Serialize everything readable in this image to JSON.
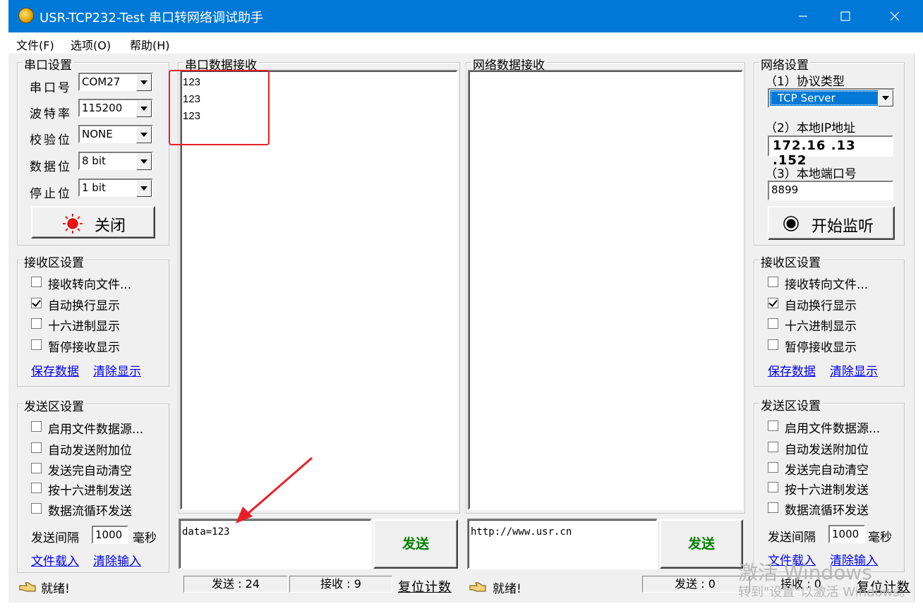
{
  "window": {
    "title": "USR-TCP232-Test 串口转网络调试助手",
    "min_icon": "minimize-icon",
    "max_icon": "maximize-icon",
    "close_icon": "close-icon"
  },
  "menu": [
    "文件(F)",
    "选项(O)",
    "帮助(H)"
  ],
  "serial_settings": {
    "legend": "串口设置",
    "fields": [
      {
        "label": "串口号",
        "value": "COM27"
      },
      {
        "label": "波特率",
        "value": "115200"
      },
      {
        "label": "校验位",
        "value": "NONE"
      },
      {
        "label": "数据位",
        "value": "8 bit"
      },
      {
        "label": "停止位",
        "value": "1 bit"
      }
    ],
    "close_button": "关闭"
  },
  "left_recv_settings": {
    "legend": "接收区设置",
    "options": [
      {
        "label": "接收转向文件...",
        "checked": false
      },
      {
        "label": "自动换行显示",
        "checked": true
      },
      {
        "label": "十六进制显示",
        "checked": false
      },
      {
        "label": "暂停接收显示",
        "checked": false
      }
    ],
    "save_link": "保存数据",
    "clear_link": "清除显示"
  },
  "left_send_settings": {
    "legend": "发送区设置",
    "options": [
      {
        "label": "启用文件数据源...",
        "checked": false
      },
      {
        "label": "自动发送附加位",
        "checked": false
      },
      {
        "label": "发送完自动清空",
        "checked": false
      },
      {
        "label": "按十六进制发送",
        "checked": false
      },
      {
        "label": "数据流循环发送",
        "checked": false
      }
    ],
    "interval_label": "发送间隔",
    "interval_value": "1000",
    "interval_unit": "毫秒",
    "load_link": "文件载入",
    "clear_link": "清除输入"
  },
  "serial_recv": {
    "legend": "串口数据接收",
    "lines": [
      "123",
      "123",
      "123"
    ],
    "send_text": "data=123",
    "send_button": "发送"
  },
  "net_recv": {
    "legend": "网络数据接收",
    "send_text": "http://www.usr.cn",
    "send_button": "发送"
  },
  "net_settings": {
    "legend": "网络设置",
    "protocol_label": "（1）协议类型",
    "protocol_value": "TCP Server",
    "ip_label": "（2）本地IP地址",
    "ip_value": "172.16 .13 .152",
    "port_label": "（3）本地端口号",
    "port_value": "8899",
    "listen_button": "开始监听"
  },
  "right_recv_settings": {
    "legend": "接收区设置",
    "options": [
      {
        "label": "接收转向文件...",
        "checked": false
      },
      {
        "label": "自动换行显示",
        "checked": true
      },
      {
        "label": "十六进制显示",
        "checked": false
      },
      {
        "label": "暂停接收显示",
        "checked": false
      }
    ],
    "save_link": "保存数据",
    "clear_link": "清除显示"
  },
  "right_send_settings": {
    "legend": "发送区设置",
    "options": [
      {
        "label": "启用文件数据源...",
        "checked": false
      },
      {
        "label": "自动发送附加位",
        "checked": false
      },
      {
        "label": "发送完自动清空",
        "checked": false
      },
      {
        "label": "按十六进制发送",
        "checked": false
      },
      {
        "label": "数据流循环发送",
        "checked": false
      }
    ],
    "interval_label": "发送间隔",
    "interval_value": "1000",
    "interval_unit": "毫秒",
    "load_link": "文件载入",
    "clear_link": "清除输入"
  },
  "status_left": {
    "ready": "就绪!",
    "sent": "发送 : 24",
    "recv": "接收 : 9",
    "reset": "复位计数"
  },
  "status_right": {
    "ready": "就绪!",
    "sent": "发送 : 0",
    "recv": "接收 : 0",
    "reset": "复位计数"
  },
  "watermark": {
    "line1": "激活 Windows",
    "line2": "转到\"设置\"以激活 Windows。"
  },
  "colors": {
    "titlebar": "#0078d7",
    "annotation": "#e8202a",
    "send_text": "#008000",
    "link": "#0000ee"
  }
}
